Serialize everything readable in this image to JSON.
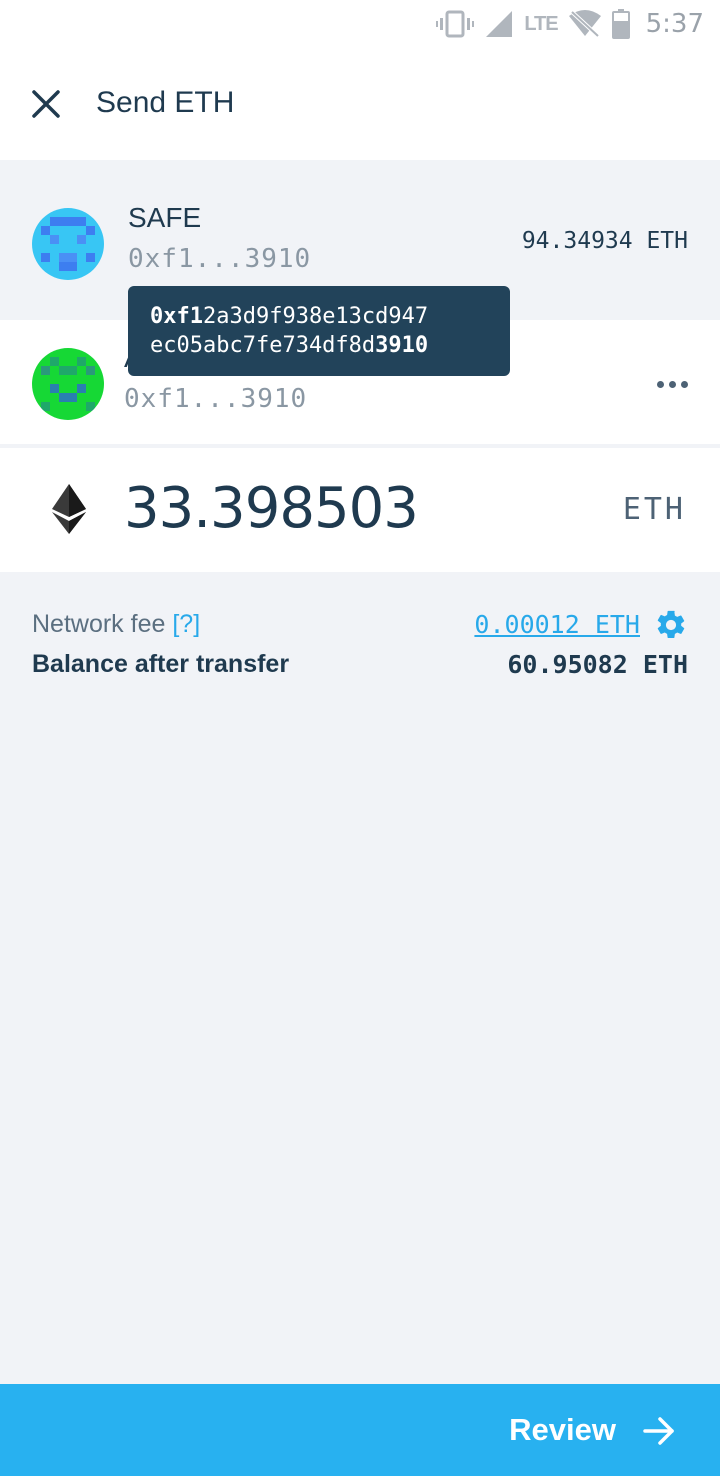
{
  "status_bar": {
    "time": "5:37",
    "network_label": "LTE",
    "icons": [
      "vibrate-icon",
      "signal-icon",
      "wifi-off-icon",
      "battery-icon"
    ]
  },
  "header": {
    "title": "Send ETH",
    "close_icon": "close-icon"
  },
  "sender": {
    "name": "SAFE",
    "address_short": "0xf1...3910",
    "balance": "94.34934 ETH"
  },
  "recipient": {
    "name_visible": "A",
    "address_short": "0xf1...3910",
    "more_icon": "more-horizontal-icon"
  },
  "tooltip": {
    "line1_bold": "0xf1",
    "line1_rest": "2a3d9f938e13cd947",
    "line2_rest": "ec05abc7fe734df8d",
    "line2_bold": "3910"
  },
  "amount": {
    "value": "33.398503",
    "unit": "ETH",
    "token_icon": "ethereum-icon"
  },
  "fee": {
    "label": "Network fee",
    "help": "[?]",
    "value": "0.00012 ETH",
    "settings_icon": "gear-icon"
  },
  "balance_after": {
    "label": "Balance after transfer",
    "value": "60.95082 ETH"
  },
  "footer": {
    "review_label": "Review",
    "arrow_icon": "arrow-right-icon"
  },
  "colors": {
    "accent": "#28b1f0",
    "link": "#28a9ea",
    "text_dark": "#1f3a4f",
    "tooltip_bg": "#22435a",
    "background": "#f1f3f7"
  }
}
